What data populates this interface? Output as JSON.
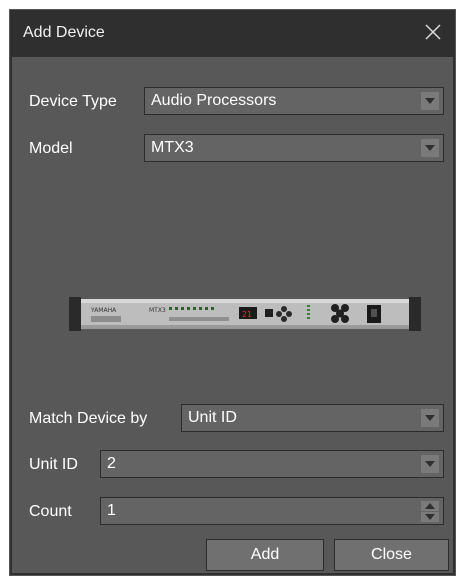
{
  "dialog": {
    "title": "Add Device",
    "close_icon": "close-icon"
  },
  "form": {
    "device_type_label": "Device Type",
    "device_type_value": "Audio Processors",
    "model_label": "Model",
    "model_value": "MTX3",
    "match_by_label": "Match Device by",
    "match_by_value": "Unit ID",
    "unit_id_label": "Unit ID",
    "unit_id_value": "2",
    "count_label": "Count",
    "count_value": "1"
  },
  "preview": {
    "device_brand": "YAMAHA",
    "device_model": "MTX3",
    "display_text": "21"
  },
  "buttons": {
    "add_label": "Add",
    "close_label": "Close"
  },
  "colors": {
    "window_bg": "#585858",
    "titlebar_bg": "#2f2f2f",
    "field_bg": "#646464",
    "button_bg": "#707070"
  }
}
